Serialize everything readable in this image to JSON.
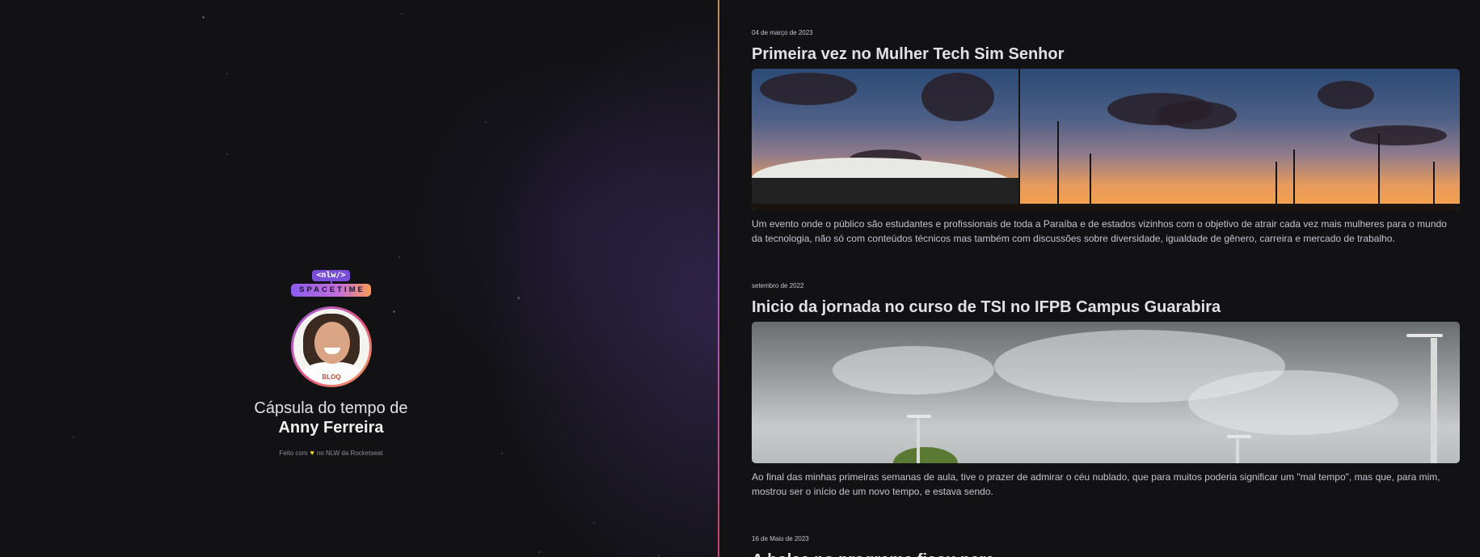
{
  "profile": {
    "logo_tag": "<nlw/>",
    "logo_main": "SPACETIME",
    "avatar_shirt_text": "BLOQ",
    "title_prefix": "Cápsula do tempo de",
    "name": "Anny Ferreira",
    "footer_before": "Feito com",
    "footer_after": "no NLW da Rocketseat",
    "heart_icon": "heart-icon"
  },
  "colors": {
    "background": "#121215",
    "divider_top": "#ba8f5a",
    "divider_bottom": "#c2456b",
    "heart": "#f3d21b"
  },
  "memories": [
    {
      "date": "04 de março de 2023",
      "title": "Primeira vez no Mulher Tech Sim Senhor",
      "text": "Um evento onde o público são estudantes e profissionais de toda a Paraíba e de estados vizinhos com o objetivo de atrair cada vez mais mulheres para o mundo da tecnologia, não só com conteúdos técnicos mas também com discussões sobre diversidade, igualdade de gênero, carreira e mercado de trabalho."
    },
    {
      "date": "setembro de 2022",
      "title": "Inicio da jornada no curso de TSI no IFPB Campus Guarabira",
      "text": "Ao final das minhas primeiras semanas de aula, tive o prazer de admirar o céu nublado, que para muitos poderia significar um \"mal tempo\", mas que, para mim, mostrou ser o início de um novo tempo, e estava sendo."
    },
    {
      "date": "16 de Maio de 2023",
      "title": "A bolsa no programa ficou para..."
    }
  ]
}
